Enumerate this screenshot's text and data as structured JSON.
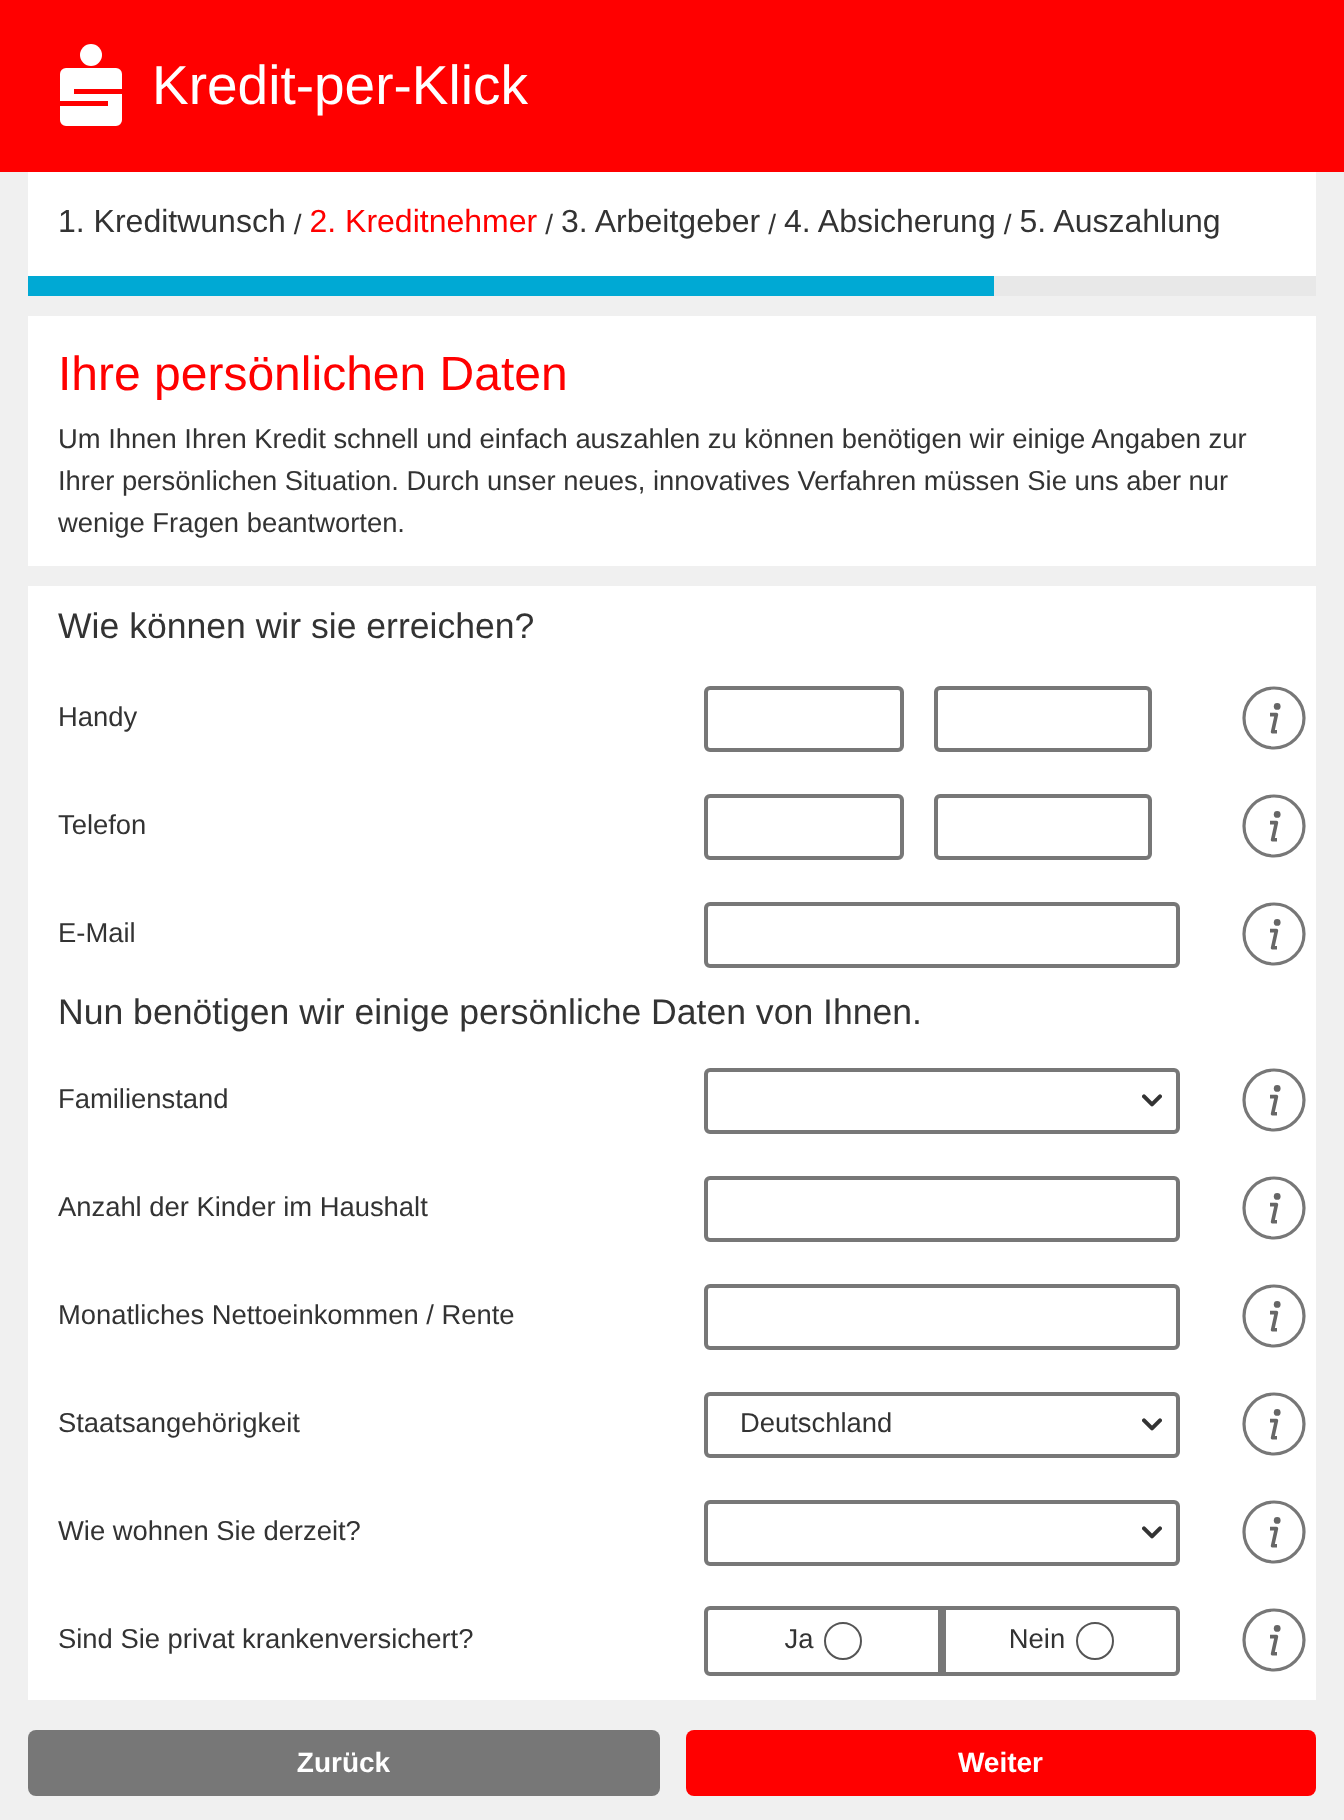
{
  "header": {
    "title": "Kredit-per-Klick"
  },
  "steps": [
    {
      "label": "1. Kreditwunsch",
      "selected": false,
      "separator": "/"
    },
    {
      "label": "2. Kreditnehmer",
      "selected": true,
      "separator": "/"
    },
    {
      "label": "3. Arbeitgeber",
      "selected": false,
      "separator": "/"
    },
    {
      "label": "4. Absicherung",
      "selected": false,
      "separator": "/"
    },
    {
      "label": "5. Auszahlung",
      "selected": false
    }
  ],
  "progress": {
    "level": 0.75
  },
  "intro": {
    "title": "Ihre persönlichen Daten",
    "text": "Um Ihnen Ihren Kredit schnell und einfach auszahlen zu können benötigen wir einige Angaben zur Ihrer persönlichen Situation. Durch unser neues, innovatives Verfahren müssen Sie uns aber nur wenige Fragen beantworten."
  },
  "sections": [
    {
      "heading": "Wie können wir sie erreichen?",
      "fields": [
        {
          "label": "Handy",
          "kind": "split"
        },
        {
          "label": "Telefon",
          "kind": "split"
        },
        {
          "label": "E-Mail",
          "kind": "text"
        }
      ]
    },
    {
      "heading": "Nun benötigen wir einige persönliche Daten von Ihnen.",
      "fields": [
        {
          "label": "Familienstand",
          "kind": "select"
        },
        {
          "label": "Anzahl der Kinder im Haushalt",
          "kind": "text"
        },
        {
          "label": "Monatliches Nettoeinkommen / Rente",
          "kind": "text"
        },
        {
          "label": "Staatsangehörigkeit",
          "kind": "select",
          "value": "Deutschland"
        },
        {
          "label": "Wie wohnen Sie derzeit?",
          "kind": "select"
        },
        {
          "label": "Sind Sie privat krankenversichert?",
          "kind": "radio",
          "options": [
            {
              "label": "Ja",
              "selected": false
            },
            {
              "label": "Nein",
              "selected": false
            }
          ]
        }
      ]
    }
  ],
  "buttons": [
    {
      "label": "Zurück",
      "kind": "back"
    },
    {
      "label": "Weiter",
      "kind": "next"
    }
  ]
}
